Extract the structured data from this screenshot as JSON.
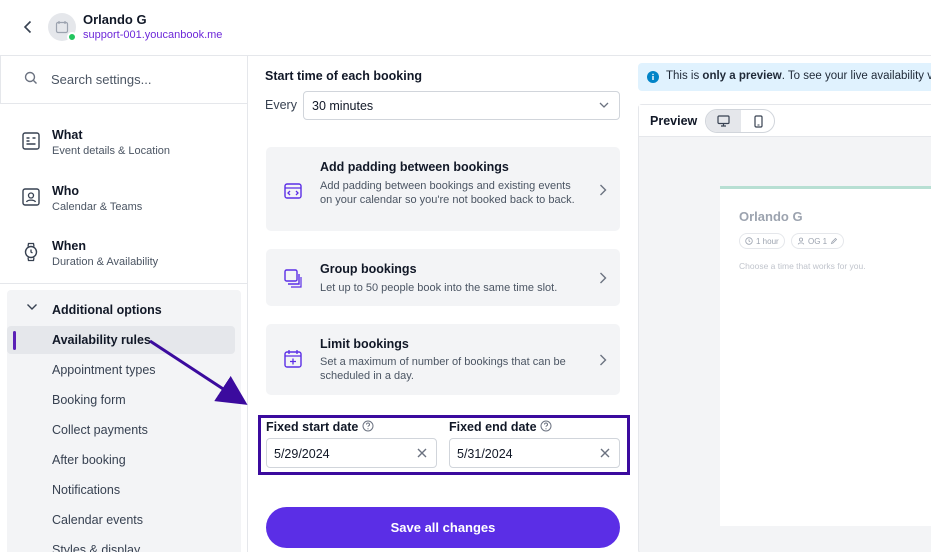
{
  "header": {
    "name": "Orlando G",
    "link": "support-001.youcanbook.me"
  },
  "sidebar": {
    "search_placeholder": "Search settings...",
    "sections": [
      {
        "title": "What",
        "subtitle": "Event details & Location",
        "icon": "form-icon"
      },
      {
        "title": "Who",
        "subtitle": "Calendar & Teams",
        "icon": "contact-card-icon"
      },
      {
        "title": "When",
        "subtitle": "Duration & Availability",
        "icon": "watch-icon"
      }
    ],
    "additional": {
      "title": "Additional options",
      "items": [
        "Availability rules",
        "Appointment types",
        "Booking form",
        "Collect payments",
        "After booking",
        "Notifications",
        "Calendar events",
        "Styles & display"
      ],
      "active": "Availability rules"
    }
  },
  "main": {
    "start_time_label": "Start time of each booking",
    "every_label": "Every",
    "interval_value": "30 minutes",
    "cards": [
      {
        "title": "Add padding between bookings",
        "desc": "Add padding between bookings and existing events on your calendar so you're not booked back to back.",
        "icon": "padding-icon"
      },
      {
        "title": "Group bookings",
        "desc": "Let up to 50 people book into the same time slot.",
        "icon": "group-icon"
      },
      {
        "title": "Limit bookings",
        "desc": "Set a maximum of number of bookings that can be scheduled in a day.",
        "icon": "calendar-limit-icon"
      }
    ],
    "fixed_start_label": "Fixed start date",
    "fixed_start_value": "5/29/2024",
    "fixed_end_label": "Fixed end date",
    "fixed_end_value": "5/31/2024",
    "save_label": "Save all changes"
  },
  "preview": {
    "banner_prefix": "This is ",
    "banner_bold": "only a preview",
    "banner_suffix": ". To see your live availability visi",
    "label": "Preview",
    "card_name": "Orlando G",
    "duration": "1 hour",
    "host": "OG 1",
    "prompt": "Choose a time that works for you."
  },
  "colors": {
    "accent": "#5b2ee6",
    "highlight_box": "#3b0b9e",
    "status_online": "#22c55e",
    "info_bg": "#e0f2fe"
  }
}
